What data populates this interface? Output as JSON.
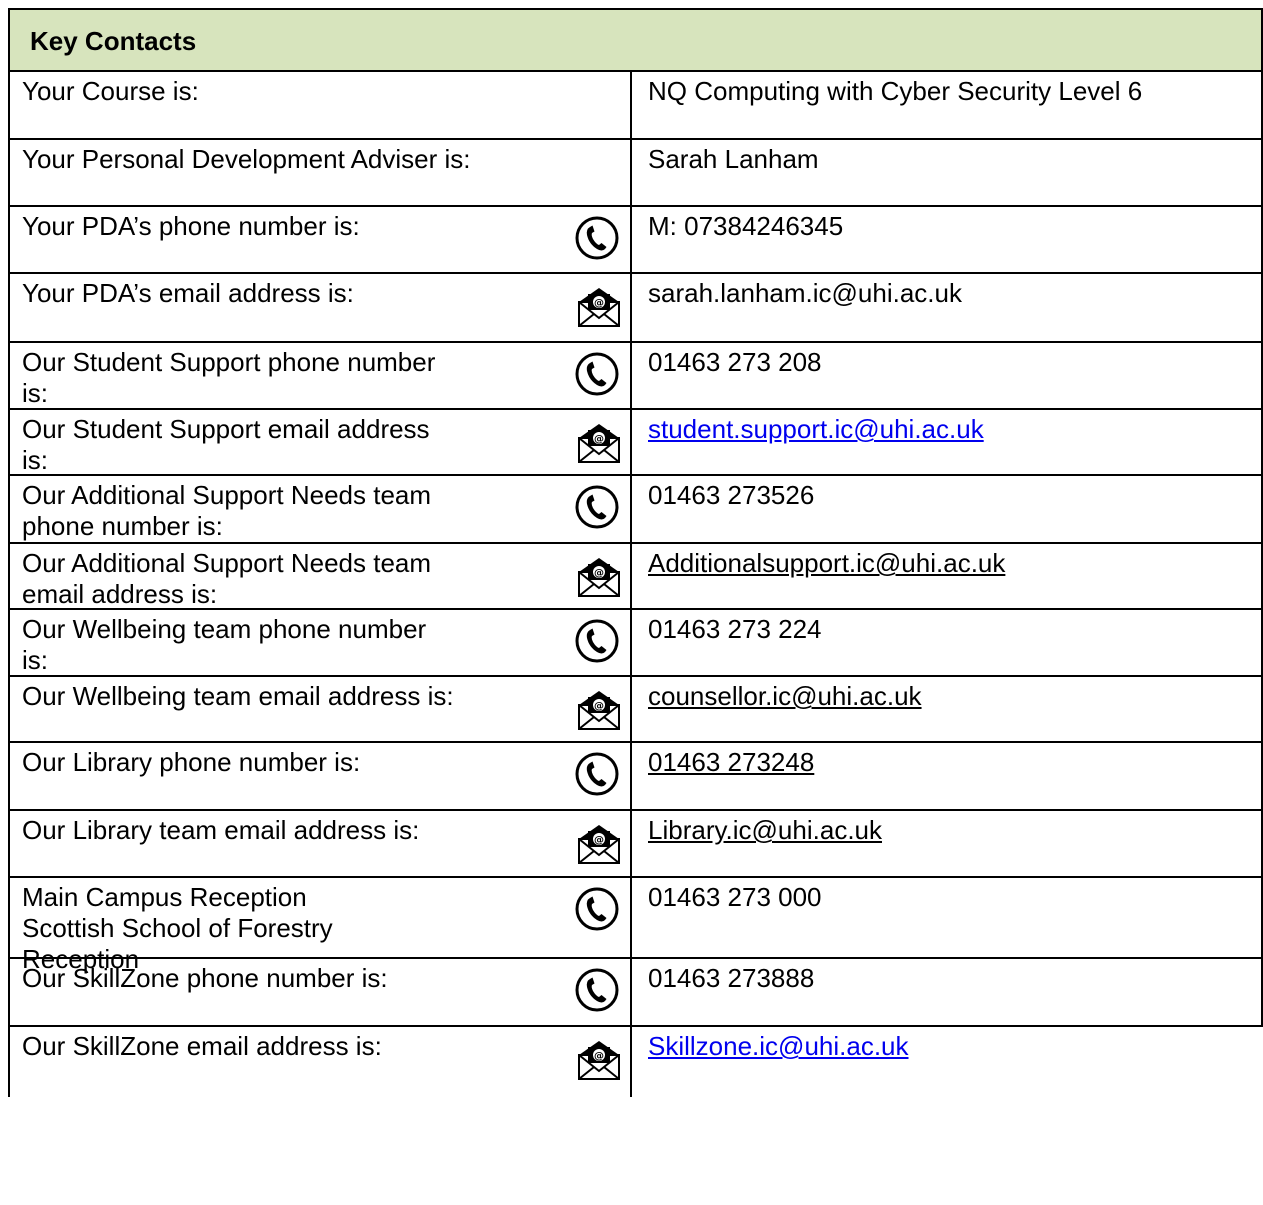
{
  "header": {
    "title": "Key Contacts"
  },
  "rows": [
    {
      "label": "Your Course is:",
      "value": "NQ Computing with Cyber Security Level 6",
      "icon": "",
      "style": "text"
    },
    {
      "label": "Your Personal Development Adviser is:",
      "value": "Sarah Lanham",
      "icon": "",
      "style": "text"
    },
    {
      "label": "Your PDA’s phone number is:",
      "value": "M: 07384246345",
      "icon": "phone-icon",
      "style": "text"
    },
    {
      "label": "Your PDA’s email address is:",
      "value": "sarah.lanham.ic@uhi.ac.uk",
      "icon": "email-icon",
      "style": "text"
    },
    {
      "label": "Our Student Support phone number\nis:",
      "value": "01463 273 208",
      "icon": "phone-icon",
      "style": "text"
    },
    {
      "label": "Our Student Support email address\nis:",
      "value": "student.support.ic@uhi.ac.uk",
      "icon": "email-icon",
      "style": "link-blue"
    },
    {
      "label": "Our Additional Support Needs team\nphone number is:",
      "value": "01463 273526",
      "icon": "phone-icon",
      "style": "text"
    },
    {
      "label": "Our Additional Support Needs team\nemail address is:",
      "value": "Additionalsupport.ic@uhi.ac.uk",
      "icon": "email-icon",
      "style": "link-black"
    },
    {
      "label": "Our Wellbeing team phone number\nis:",
      "value": "01463 273 224",
      "icon": "phone-icon",
      "style": "text"
    },
    {
      "label": "Our Wellbeing team email address is:",
      "value": "counsellor.ic@uhi.ac.uk",
      "icon": "email-icon",
      "style": "link-black"
    },
    {
      "label": "Our Library phone number is:",
      "value": "01463 273248",
      "icon": "phone-icon",
      "style": "link-black"
    },
    {
      "label": "Our Library team email address is:",
      "value": "Library.ic@uhi.ac.uk",
      "icon": "email-icon",
      "style": "link-black"
    },
    {
      "label": "Main Campus Reception\nScottish School of Forestry\nReception",
      "value": "01463 273 000",
      "icon": "phone-icon",
      "style": "text"
    },
    {
      "label": "Our SkillZone phone number is:",
      "value": "01463 273888",
      "icon": "phone-icon",
      "style": "text"
    },
    {
      "label": "Our SkillZone email address is:",
      "value": "Skillzone.ic@uhi.ac.uk",
      "icon": "email-icon",
      "style": "link-blue"
    }
  ],
  "colors": {
    "header_bg": "#d7e4bd",
    "link_blue": "#0000ee",
    "border": "#000000"
  }
}
